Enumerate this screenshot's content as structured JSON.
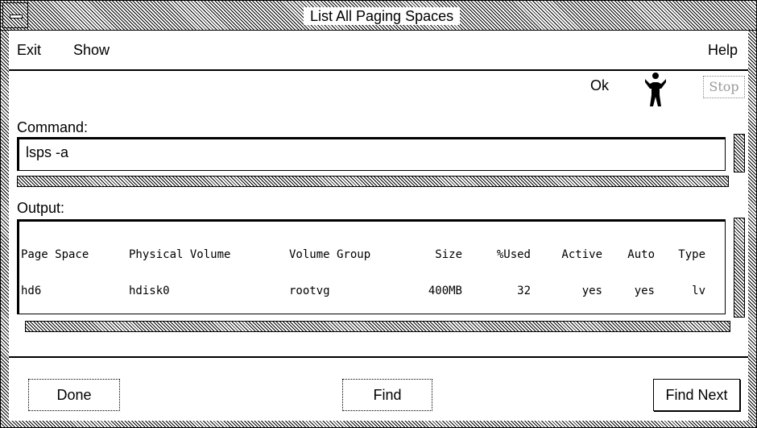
{
  "window": {
    "title": "List All Paging Spaces"
  },
  "menu": {
    "exit": "Exit",
    "show": "Show",
    "help": "Help"
  },
  "status": {
    "text": "Ok",
    "stop_label": "Stop",
    "running_icon": "figure-icon"
  },
  "command": {
    "label": "Command:",
    "value": "lsps -a"
  },
  "output": {
    "label": "Output:",
    "columns": [
      "Page Space",
      "Physical Volume",
      "Volume Group",
      "Size",
      "%Used",
      "Active",
      "Auto",
      "Type"
    ],
    "rows": [
      [
        "hd6",
        "hdisk0",
        "rootvg",
        "400MB",
        "32",
        "yes",
        "yes",
        "lv"
      ]
    ]
  },
  "buttons": {
    "done": "Done",
    "find": "Find",
    "find_next": "Find Next"
  }
}
